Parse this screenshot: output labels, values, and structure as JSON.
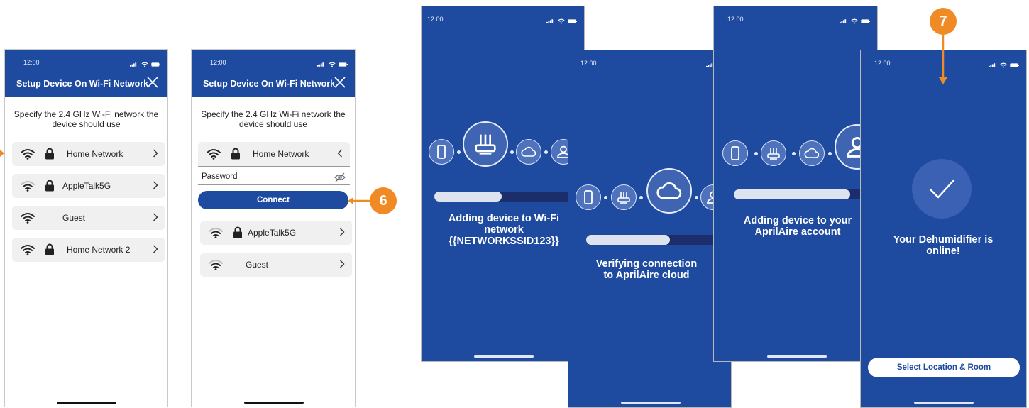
{
  "status_time": "12:00",
  "setup_header": {
    "title": "Setup Device On Wi-Fi Network"
  },
  "instruction": "Specify the 2.4 GHz Wi-Fi network the device should use",
  "networks_list": [
    {
      "name": "Home Network",
      "locked": true,
      "signal": "strong",
      "chevron": "right"
    },
    {
      "name": "AppleTalk5G",
      "locked": true,
      "signal": "medium",
      "chevron": "right"
    },
    {
      "name": "Guest",
      "locked": false,
      "signal": "strong",
      "chevron": "right"
    },
    {
      "name": "Home Network 2",
      "locked": true,
      "signal": "strong",
      "chevron": "right"
    }
  ],
  "expanded_network": {
    "name": "Home Network",
    "chevron": "left"
  },
  "password_label": "Password",
  "connect_label": "Connect",
  "networks_after": [
    {
      "name": "AppleTalk5G",
      "locked": true
    },
    {
      "name": "Guest",
      "locked": false
    }
  ],
  "callouts": {
    "connect_step": "6",
    "online_step": "7"
  },
  "accent_color": "#1e4aa0",
  "callout_color": "#f08a24",
  "progress_screens": [
    {
      "title": "Adding device to Wi-Fi network {{NETWORKSSID123}}",
      "progress": 0.43,
      "active_icon": "router-icon"
    },
    {
      "title": "Verifying connection to AprilAire cloud",
      "progress": 0.56,
      "active_icon": "cloud-icon"
    },
    {
      "title": "Adding device to your AprilAire account",
      "progress": 0.78,
      "active_icon": "user-icon"
    }
  ],
  "success": {
    "message": "Your Dehumidifier is online!",
    "button": "Select Location & Room"
  }
}
